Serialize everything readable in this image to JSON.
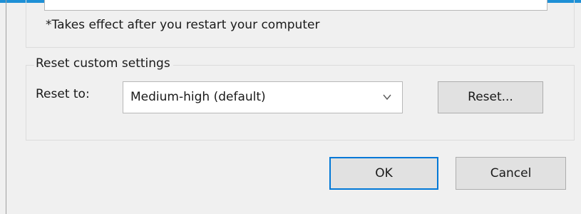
{
  "security_dialog": {
    "restart_note": "*Takes effect after you restart your computer",
    "reset_group": {
      "legend": "Reset custom settings",
      "reset_to_label": "Reset to:",
      "reset_level_value": "Medium-high (default)",
      "reset_button": "Reset..."
    },
    "footer": {
      "ok_button": "OK",
      "cancel_button": "Cancel"
    }
  },
  "icons": {
    "dropdown": "chevron-down-icon"
  },
  "colors": {
    "window_accent": "#1e90d6",
    "default_button_border": "#0078d7",
    "dialog_background": "#f0f0f0",
    "button_background": "#e1e1e1"
  }
}
